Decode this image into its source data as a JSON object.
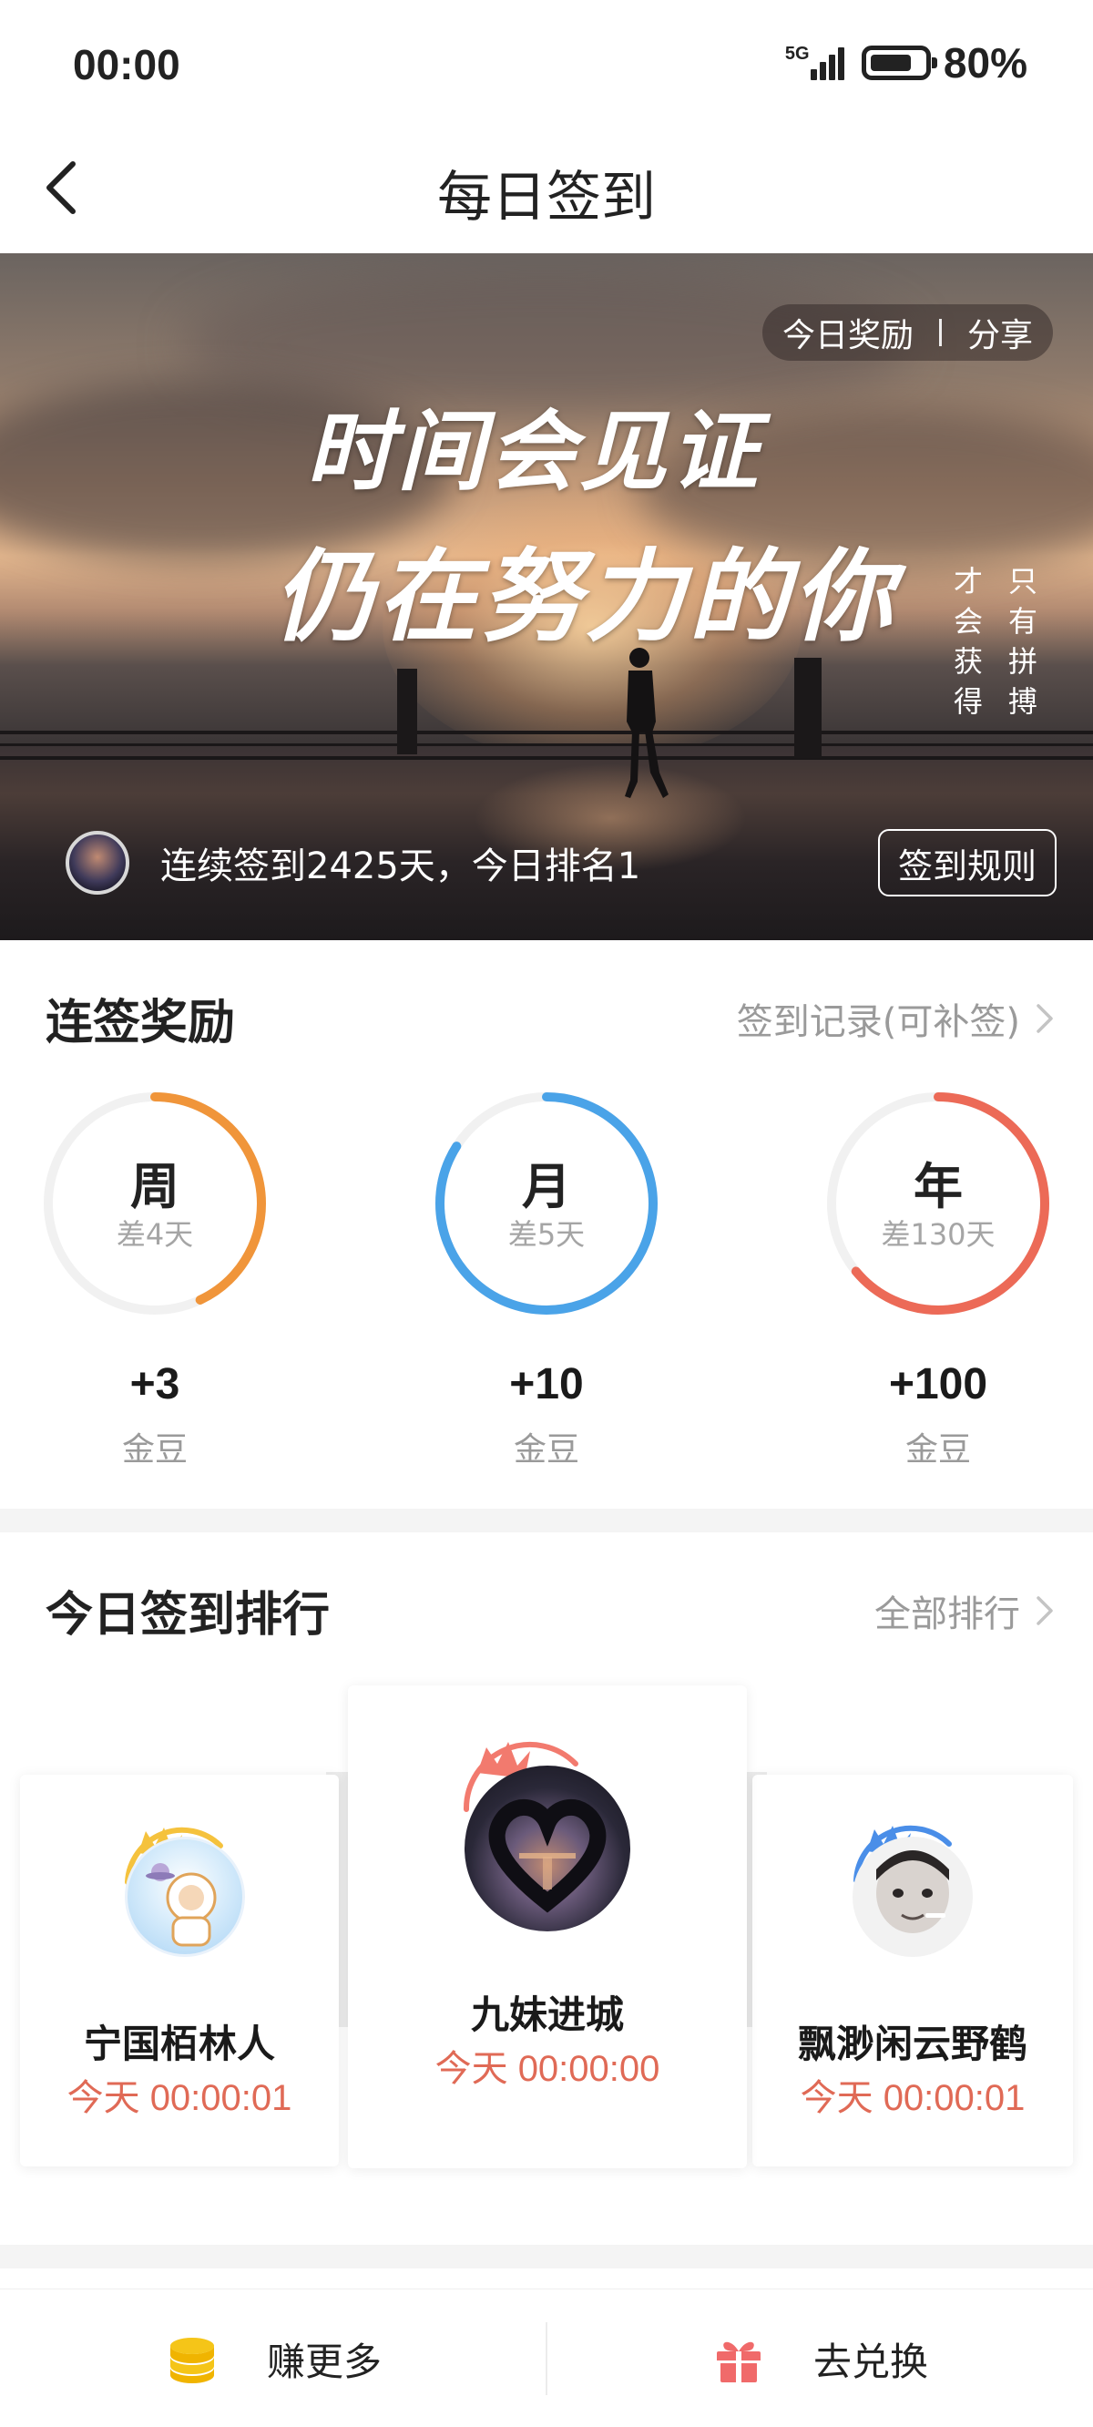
{
  "status_bar": {
    "time": "00:00",
    "network": "5G",
    "battery": "80%"
  },
  "nav": {
    "title": "每日签到",
    "back_icon": "chevron-left-icon"
  },
  "banner": {
    "reward_link": "今日奖励",
    "share_link": "分享",
    "slogan_line1": "时间会见证",
    "slogan_line2": "仍在努力的你",
    "side_text": [
      "只有拼搏",
      "才会获得"
    ],
    "streak_text": "连续签到2425天，今日排名1",
    "rules_button": "签到规则"
  },
  "streak_rewards": {
    "title": "连签奖励",
    "history_link": "签到记录(可补签)",
    "rings": [
      {
        "label": "周",
        "remaining": "差4天",
        "amount": "+3",
        "unit": "金豆",
        "progress": 0.43,
        "color": "#f0953a"
      },
      {
        "label": "月",
        "remaining": "差5天",
        "amount": "+10",
        "unit": "金豆",
        "progress": 0.84,
        "color": "#4aa3e8"
      },
      {
        "label": "年",
        "remaining": "差130天",
        "amount": "+100",
        "unit": "金豆",
        "progress": 0.64,
        "color": "#ec6a57"
      }
    ]
  },
  "ranking": {
    "title": "今日签到排行",
    "all_link": "全部排行",
    "entries": [
      {
        "rank": 1,
        "name": "九妹进城",
        "time": "今天 00:00:00",
        "crown_color": "#f27a6e"
      },
      {
        "rank": 2,
        "name": "宁国栢林人",
        "time": "今天 00:00:01",
        "crown_color": "#f5c23d"
      },
      {
        "rank": 3,
        "name": "飘渺闲云野鹤",
        "time": "今天 00:00:01",
        "crown_color": "#4a8ee8"
      }
    ]
  },
  "bottom_bar": {
    "earn_label": "赚更多",
    "earn_icon": "coin-stack-icon",
    "redeem_label": "去兑换",
    "redeem_icon": "gift-icon",
    "colors": {
      "coin": "#f5c518",
      "gift": "#f06a6a"
    }
  }
}
